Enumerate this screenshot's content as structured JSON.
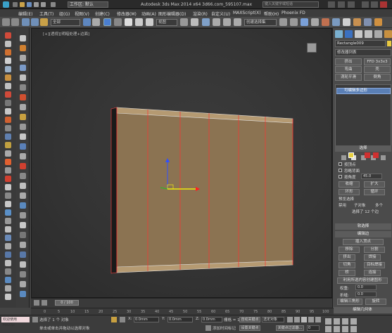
{
  "title_bar": {
    "workspace": "工作区: 默认",
    "title": "Autodesk 3ds Max  2014 x64     3d66.com_595107.max",
    "search_placeholder": "键入关键字或短语"
  },
  "menu": [
    "编辑(E)",
    "工具(T)",
    "组(G)",
    "视图(V)",
    "创建(C)",
    "修改器(M)",
    "动画(A)",
    "图形编辑器(D)",
    "渲染(R)",
    "自定义(U)",
    "MAXScript(X)",
    "帮助(H)",
    "Phoenix FD"
  ],
  "toolbar": {
    "filter": "全部",
    "viewport_mode": "视图",
    "selection_set": "创建选择集"
  },
  "viewport": {
    "label": "[+][透视][明暗处理+边面]"
  },
  "command_panel": {
    "object_name": "Rectangle009",
    "modifier_list": "修改器列表",
    "buttons": {
      "extrude": "挤出",
      "ffd": "FFD 3x3x3",
      "bend": "弯曲",
      "shell": "壳",
      "turbosmooth": "涡轮平滑",
      "chamfer": "倒角"
    },
    "stack": [
      "可编辑多边形"
    ],
    "selection_rollout": "选择",
    "by_vertex": "按顶点",
    "ignore_backfacing": "忽略背面",
    "by_angle": "按角度",
    "angle_value": "45.0",
    "shrink": "收缩",
    "grow": "扩大",
    "ring": "环形",
    "loop": "循环",
    "preview_selection": "预览选择",
    "preview_disabled": "禁用",
    "preview_subobj": "子对象",
    "preview_multi": "多个",
    "selection_status": "选择了 12 个边",
    "soft_selection": "软选择",
    "edit_edges": "编辑边",
    "insert_vertex": "插入顶点",
    "remove": "移除",
    "split": "分割",
    "extrude_edge": "挤出",
    "weld": "焊接",
    "chamfer_edge": "切角",
    "target_weld": "目标焊接",
    "bridge": "桥",
    "connect": "连接",
    "create_shape": "利用所选内容创建图形",
    "weight_label": "权重:",
    "weight_value": "0.0",
    "crease_label": "折缝:",
    "crease_value": "0.0",
    "edit_tri": "编辑三角形",
    "turn": "旋转",
    "edit_geometry": "编辑几何体"
  },
  "timeline": {
    "frame": "0 / 100",
    "ticks": [
      "0",
      "5",
      "10",
      "15",
      "20",
      "25",
      "30",
      "35",
      "40",
      "45",
      "50",
      "55",
      "60",
      "65",
      "70",
      "75",
      "80",
      "85",
      "90",
      "95",
      "100"
    ]
  },
  "status": {
    "welcome": "欢迎使用 MAXSc",
    "selected": "选择了 1 个 对象",
    "prompt": "单击或单击并拖动以选择对象",
    "x_label": "X:",
    "x_value": "0.0mm",
    "y_label": "Y:",
    "y_value": "0.0mm",
    "z_label": "Z:",
    "z_value": "0.0mm",
    "grid": "栅格 = 10.0mm",
    "add_time_tag": "添加时间标记",
    "auto_key": "自动关键点",
    "selected_obj": "选定对象",
    "set_key": "设置关键点",
    "key_filters": "关键点过滤器...",
    "frame_value": "0"
  }
}
